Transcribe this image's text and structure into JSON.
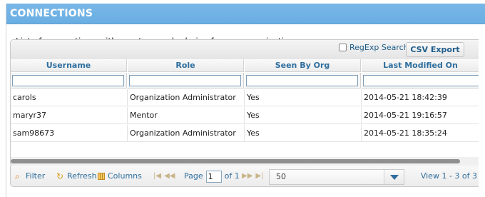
{
  "panel": {
    "title": "CONNECTIONS",
    "description": "List of connections with mentors and admins for my organizations."
  },
  "toolbar": {
    "regexp_label": "RegExp Search",
    "regexp_checked": false,
    "csv_export_label": "CSV Export"
  },
  "table": {
    "columns": [
      "Username",
      "Role",
      "Seen By Org",
      "Last Modified On"
    ],
    "filters": [
      "",
      "",
      "",
      ""
    ],
    "rows": [
      [
        "carols",
        "Organization Administrator",
        "Yes",
        "2014-05-21 18:42:39"
      ],
      [
        "maryr37",
        "Mentor",
        "Yes",
        "2014-05-21 19:16:57"
      ],
      [
        "sam98673",
        "Organization Administrator",
        "Yes",
        "2014-05-21 18:35:24"
      ]
    ]
  },
  "pager": {
    "filter_label": "Filter",
    "refresh_label": "Refresh",
    "columns_label": "Columns",
    "page_label": "Page",
    "page_value": "1",
    "of_label": "of 1",
    "rows_per_page": "50",
    "view_text": "View 1 - 3 of 3"
  },
  "colors": {
    "header_blue": "#6aaee2",
    "link_blue": "#2e6e9e"
  }
}
